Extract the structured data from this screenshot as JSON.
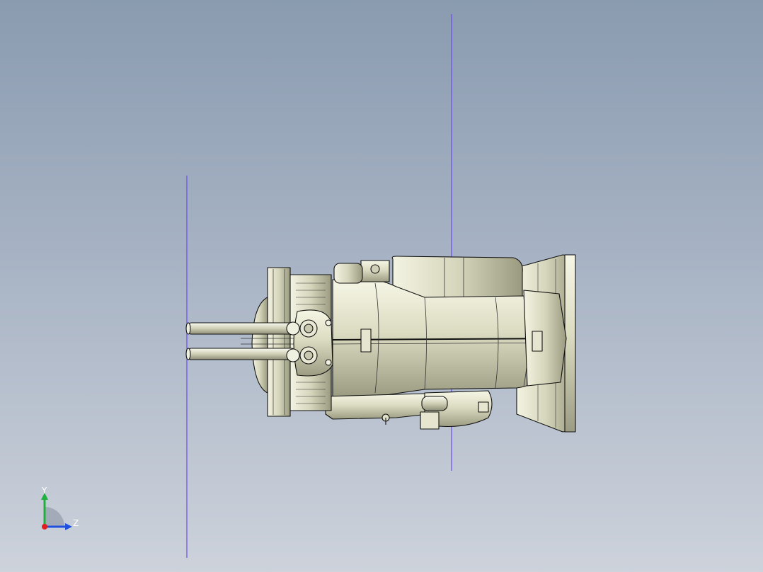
{
  "colors": {
    "background_top": "#8a9bb0",
    "background_bottom": "#cdd2db",
    "plane_line": "#6a4cf0",
    "model_body": "#ddddc4",
    "model_shadow": "#8a8a72",
    "outline": "#111111",
    "axis_x": "#e02020",
    "axis_y": "#20b040",
    "axis_z": "#2050e0"
  },
  "triad": {
    "y_label": "Y",
    "z_label": "Z"
  },
  "icons": [
    "heater-core-assembly-model",
    "coordinate-triad-icon"
  ]
}
